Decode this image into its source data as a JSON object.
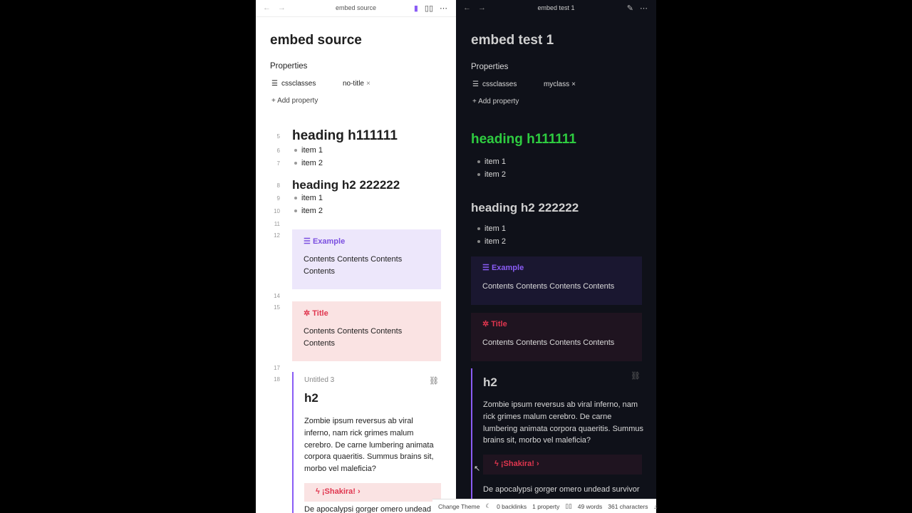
{
  "left": {
    "tab_title": "embed source",
    "note_title": "embed source",
    "properties_label": "Properties",
    "prop_key": "cssclasses",
    "prop_value": "no-title",
    "add_property": "Add property",
    "line_numbers": [
      "5",
      "6",
      "7",
      "8",
      "9",
      "10",
      "11",
      "12",
      "14",
      "15",
      "17",
      "18"
    ],
    "heading1": "heading h111111",
    "h1_items": [
      "item 1",
      "item 2"
    ],
    "heading2": "heading h2 222222",
    "h2_items": [
      "item 1",
      "item 2"
    ],
    "callout_example_title": "Example",
    "callout_example_body": "Contents Contents Contents Contents",
    "callout_bug_title": "Title",
    "callout_bug_body": "Contents Contents Contents Contents",
    "embed_title": "Untitled 3",
    "embed_heading": "h2",
    "embed_para": "Zombie ipsum reversus ab viral inferno, nam rick grimes malum cerebro. De carne lumbering animata corpora quaeritis. Summus brains sit, morbo vel maleficia?",
    "shakira": "¡Shakira!",
    "apocalypsi": "De apocalypsi gorger omero undead"
  },
  "right": {
    "tab_title": "embed test 1",
    "note_title": "embed test 1",
    "properties_label": "Properties",
    "prop_key": "cssclasses",
    "prop_value": "myclass",
    "add_property": "Add property",
    "heading1": "heading h111111",
    "h1_items": [
      "item 1",
      "item 2"
    ],
    "heading2": "heading h2 222222",
    "h2_items": [
      "item 1",
      "item 2"
    ],
    "callout_example_title": "Example",
    "callout_example_body": "Contents Contents Contents Contents",
    "callout_bug_title": "Title",
    "callout_bug_body": "Contents Contents Contents Contents",
    "embed_heading": "h2",
    "embed_para": "Zombie ipsum reversus ab viral inferno, nam rick grimes malum cerebro. De carne lumbering animata corpora quaeritis. Summus brains sit, morbo vel maleficia?",
    "shakira": "¡Shakira!",
    "apocalypsi": "De apocalypsi gorger omero undead survivor"
  },
  "status": {
    "change_theme": "Change Theme",
    "backlinks": "0 backlinks",
    "properties": "1 property",
    "words": "49 words",
    "characters": "361 characters"
  },
  "colors": {
    "accent": "#8a5cf5",
    "h1_green": "#2ecc40",
    "bug_red": "#e0364f",
    "example_purple": "#7b4fe0"
  },
  "icons": [
    "back-arrow-icon",
    "forward-arrow-icon",
    "bookmark-icon",
    "book-icon",
    "more-icon",
    "edit-icon",
    "list-icon",
    "plus-icon",
    "bug-icon",
    "link-icon",
    "bolt-icon",
    "chevron-right-icon",
    "moon-icon",
    "bell-icon"
  ]
}
